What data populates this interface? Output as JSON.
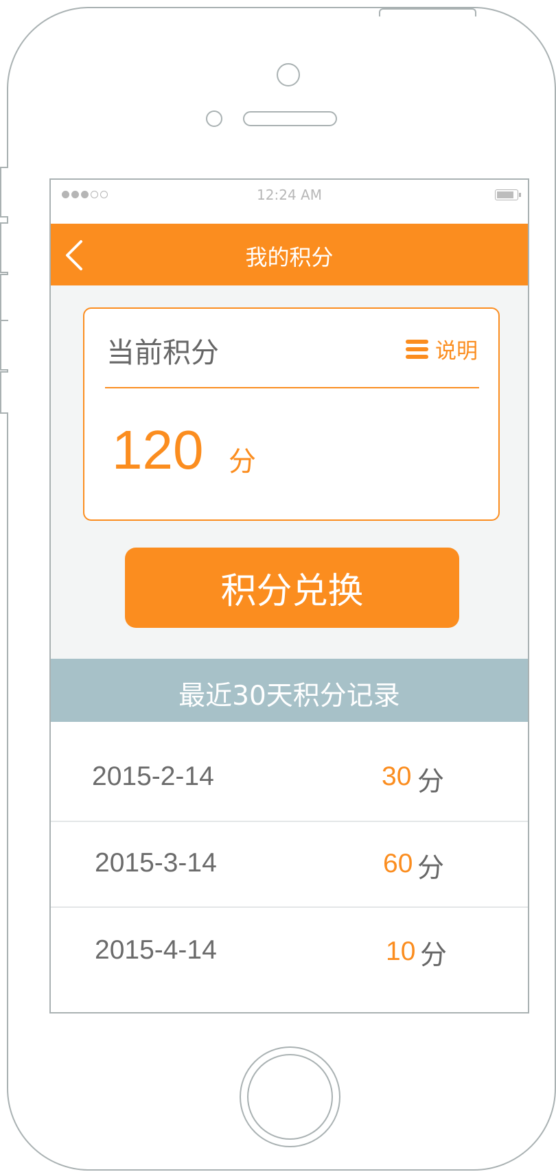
{
  "status_bar": {
    "time": "12:24 AM",
    "signal_dots_filled": 3,
    "signal_dots_total": 5
  },
  "nav": {
    "title": "我的积分",
    "back_icon": "chevron-left-icon"
  },
  "points_card": {
    "label": "当前积分",
    "explain_label": "说明",
    "explain_icon": "list-icon",
    "value": "120",
    "unit": "分"
  },
  "exchange_button": {
    "label": "积分兑换"
  },
  "records_section": {
    "title": "最近30天积分记录",
    "items": [
      {
        "date": "2015-2-14",
        "points": "30",
        "unit": "分"
      },
      {
        "date": "2015-3-14",
        "points": "60",
        "unit": "分"
      },
      {
        "date": "2015-4-14",
        "points": "10",
        "unit": "分"
      }
    ]
  },
  "colors": {
    "accent": "#fb8d1f",
    "section_header": "#a7c1c8",
    "frame": "#a9b1b2"
  }
}
